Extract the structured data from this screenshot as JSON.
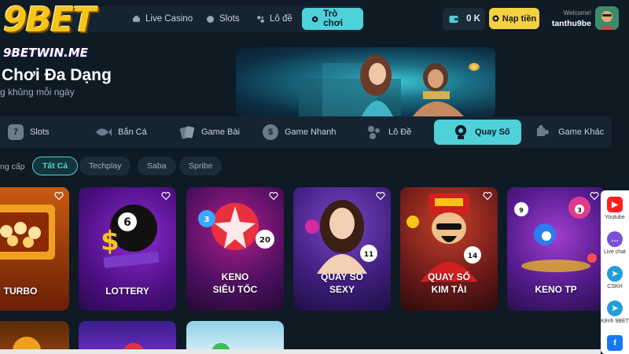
{
  "brand": {
    "logo_text": "9BET",
    "logo_url_text": "9BETWIN.ME"
  },
  "nav": {
    "items": [
      {
        "label": "Live Casino",
        "icon": "live-casino-icon"
      },
      {
        "label": "Slots",
        "icon": "slots-icon"
      },
      {
        "label": "Lô đề",
        "icon": "lottery-icon"
      },
      {
        "label": "Trò chơi",
        "icon": "game-icon",
        "active": true
      }
    ]
  },
  "account": {
    "balance": "0 K",
    "deposit_label": "Nạp tiền",
    "welcome": "Welcome!",
    "username": "tanthu9be"
  },
  "hero": {
    "title": "Chơi Đa Dạng",
    "subtitle": "g khủng mỗi ngày"
  },
  "categories": [
    {
      "label": "Slots",
      "icon": "7"
    },
    {
      "label": "Bắn Cá",
      "icon": "fish-icon"
    },
    {
      "label": "Game Bài",
      "icon": "cards-icon"
    },
    {
      "label": "Game Nhanh",
      "icon": "$"
    },
    {
      "label": "Lô Đề",
      "icon": "dice-icon"
    },
    {
      "label": "Quay Số",
      "icon": "lottery-machine-icon",
      "active": true
    },
    {
      "label": "Game Khác",
      "icon": "puzzle-icon"
    }
  ],
  "filters": {
    "label": "ng cấp",
    "chips": [
      {
        "label": "Tất Cả",
        "active": true
      },
      {
        "label": "Techplay"
      },
      {
        "label": "Saba"
      },
      {
        "label": "Spribe"
      }
    ]
  },
  "games": [
    {
      "name_line1": "TURBO",
      "name_line2": ""
    },
    {
      "name_line1": "LOTTERY",
      "name_line2": ""
    },
    {
      "name_line1": "KENO",
      "name_line2": "SIÊU TỐC"
    },
    {
      "name_line1": "QUAY SỐ",
      "name_line2": "SEXY"
    },
    {
      "name_line1": "QUAY SỐ",
      "name_line2": "KIM TÀI"
    },
    {
      "name_line1": "KENO TP",
      "name_line2": ""
    }
  ],
  "side_panel": [
    {
      "label": "Youtube",
      "color": "#ff1e1e",
      "icon": "youtube-icon"
    },
    {
      "label": "Live chat",
      "color": "#7b4fd8",
      "icon": "chat-icon"
    },
    {
      "label": "CSKH",
      "color": "#229ed9",
      "icon": "telegram-icon"
    },
    {
      "label": "Kênh 9BET",
      "color": "#229ed9",
      "icon": "telegram-icon"
    },
    {
      "label": "",
      "color": "#1877f2",
      "icon": "facebook-icon"
    }
  ],
  "colors": {
    "accent": "#4fd1d9",
    "deposit": "#f5d142",
    "background": "#0e1a24"
  }
}
